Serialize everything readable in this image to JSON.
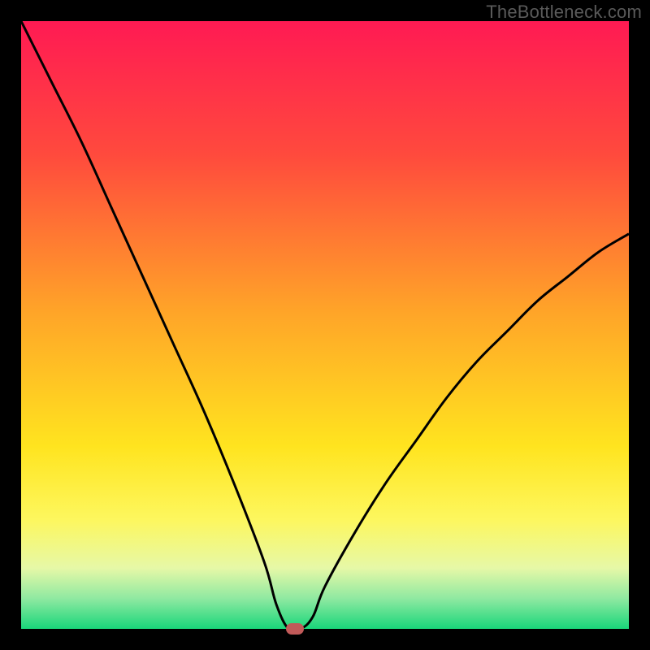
{
  "watermark": "TheBottleneck.com",
  "chart_data": {
    "type": "line",
    "title": "",
    "xlabel": "",
    "ylabel": "",
    "xlim": [
      0,
      100
    ],
    "ylim": [
      0,
      100
    ],
    "x": [
      0,
      5,
      10,
      15,
      20,
      25,
      30,
      35,
      40,
      42,
      44,
      46,
      48,
      50,
      55,
      60,
      65,
      70,
      75,
      80,
      85,
      90,
      95,
      100
    ],
    "values": [
      100,
      90,
      80,
      69,
      58,
      47,
      36,
      24,
      11,
      4,
      0,
      0,
      2,
      7,
      16,
      24,
      31,
      38,
      44,
      49,
      54,
      58,
      62,
      65
    ],
    "marker": {
      "x": 45,
      "y": 0
    },
    "background_gradient": {
      "stops": [
        {
          "pos": 0,
          "color": "#ff1a53"
        },
        {
          "pos": 22,
          "color": "#ff4a3d"
        },
        {
          "pos": 48,
          "color": "#ffa528"
        },
        {
          "pos": 70,
          "color": "#ffe41f"
        },
        {
          "pos": 82,
          "color": "#fdf75e"
        },
        {
          "pos": 90,
          "color": "#e6f8a7"
        },
        {
          "pos": 95,
          "color": "#8fe9a1"
        },
        {
          "pos": 100,
          "color": "#19d67a"
        }
      ]
    }
  }
}
